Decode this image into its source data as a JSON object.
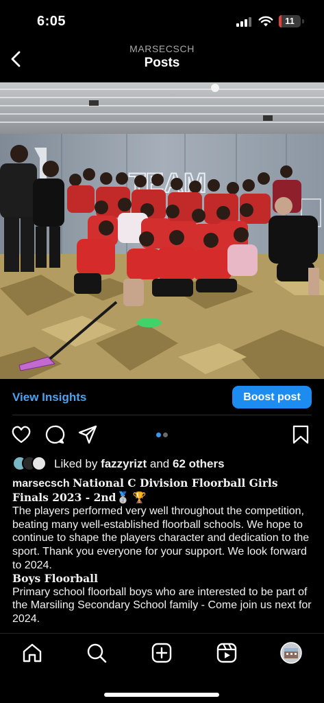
{
  "status_bar": {
    "time": "6:05",
    "battery_level": "11",
    "battery_color": "#e0413a"
  },
  "header": {
    "account_name": "MARSECSCH",
    "title": "Posts",
    "back_icon": "chevron-left-icon"
  },
  "post": {
    "photo_sign_text": "TEAM",
    "view_insights_label": "View Insights",
    "boost_label": "Boost post",
    "accent_color": "#1d8cf0",
    "carousel": {
      "count": 2,
      "active": 0
    },
    "liked_by_prefix": "Liked by",
    "liked_by_user": "fazzyrizt",
    "liked_by_and": "and",
    "liked_by_others": "62 others",
    "caption": {
      "username": "marsecsch",
      "headline": "National C Division Floorball Girls Finals 2023 - 2nd",
      "headline_emoji": "🥈 🏆",
      "body1": "The players performed very well throughout the competition, beating many well-established floorball schools. We hope to continue to shape the players character and dedication to the sport. Thank you everyone for your support. We look forward to 2024.",
      "subheading": "Boys Floorball",
      "body2": "Primary school floorball boys who are interested to be part of the Marsiling Secondary School family - Come join us next for 2024."
    }
  },
  "bottom_nav": {
    "items": [
      "home-icon",
      "search-icon",
      "create-icon",
      "reels-icon",
      "profile-avatar"
    ]
  }
}
